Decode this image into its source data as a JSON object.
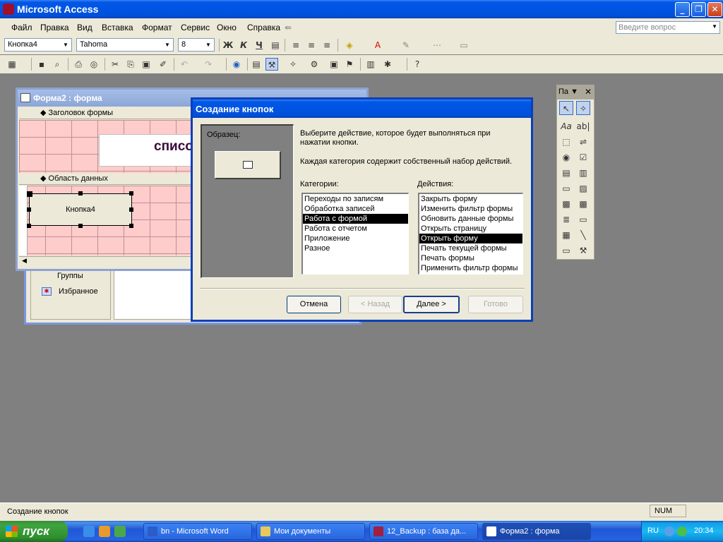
{
  "app": {
    "title": "Microsoft Access"
  },
  "menu": {
    "items": [
      "Файл",
      "Правка",
      "Вид",
      "Вставка",
      "Формат",
      "Сервис",
      "Окно",
      "Справка"
    ],
    "ask_placeholder": "Введите вопрос"
  },
  "format_toolbar": {
    "object": "Кнопка4",
    "font": "Tahoma",
    "size": "8",
    "bold": "Ж",
    "italic": "К",
    "underline": "Ч"
  },
  "form_window": {
    "title": "Форма2 : форма",
    "header_section": "Заголовок формы",
    "detail_section": "Область данных",
    "header_label": "списо",
    "button_control": "Кнопка4"
  },
  "db_window": {
    "groups_label": "Группы",
    "favorites": "Избранное"
  },
  "toolbox": {
    "title": "Па"
  },
  "dialog": {
    "title": "Создание кнопок",
    "sample_label": "Образец:",
    "instruction": "Выберите действие, которое будет выполняться при нажатии кнопки.",
    "note": "Каждая категория содержит собственный набор действий.",
    "categories_label": "Категории:",
    "actions_label": "Действия:",
    "categories": [
      "Переходы по записям",
      "Обработка записей",
      "Работа с формой",
      "Работа с отчетом",
      "Приложение",
      "Разное"
    ],
    "selected_category": 2,
    "actions": [
      "Закрыть форму",
      "Изменить фильтр формы",
      "Обновить данные формы",
      "Открыть страницу",
      "Открыть форму",
      "Печать текущей формы",
      "Печать формы",
      "Применить фильтр формы"
    ],
    "selected_action": 4,
    "buttons": {
      "cancel": "Отмена",
      "back": "< Назад",
      "next": "Далее >",
      "finish": "Готово"
    }
  },
  "status": {
    "text": "Создание кнопок",
    "num": "NUM"
  },
  "taskbar": {
    "start": "пуск",
    "tasks": [
      "bn - Microsoft Word",
      "Мои документы",
      "12_Backup : база да...",
      "Форма2 : форма"
    ],
    "lang": "RU",
    "time": "20:34"
  },
  "colors": {
    "title_blue": "#0054e3",
    "grid_pink": "#ffcccc",
    "taskbar_blue": "#2457d7",
    "start_green": "#3ea53e"
  }
}
